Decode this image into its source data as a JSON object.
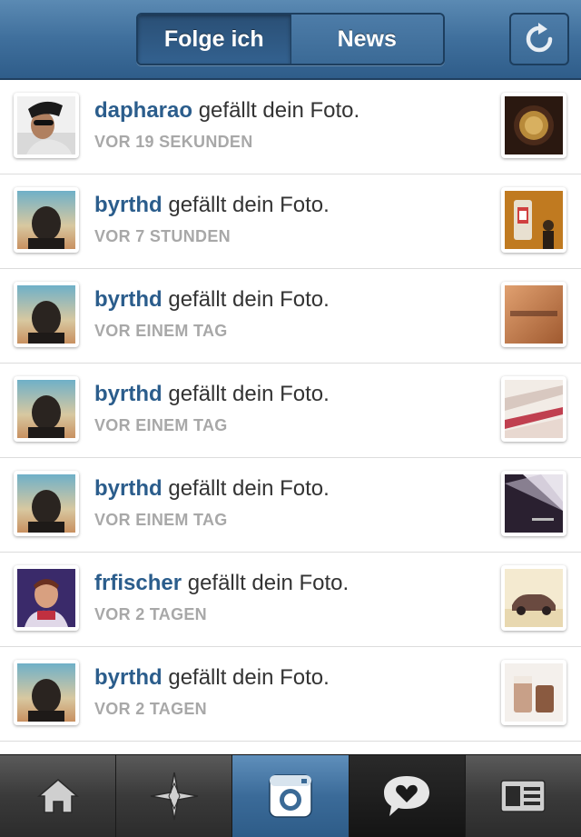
{
  "header": {
    "tabs": [
      {
        "label": "Folge ich",
        "active": true
      },
      {
        "label": "News",
        "active": false
      }
    ],
    "refresh_icon": "refresh-icon"
  },
  "colors": {
    "header_blue": "#3f6f9c",
    "username_blue": "#2b5d8c",
    "timestamp_gray": "#a8a8a8"
  },
  "activity": [
    {
      "user": "dapharao",
      "action": "gefällt dein Foto.",
      "time": "VOR 19 SEKUNDEN"
    },
    {
      "user": "byrthd",
      "action": "gefällt dein Foto.",
      "time": "VOR 7 STUNDEN"
    },
    {
      "user": "byrthd",
      "action": "gefällt dein Foto.",
      "time": "VOR EINEM TAG"
    },
    {
      "user": "byrthd",
      "action": "gefällt dein Foto.",
      "time": "VOR EINEM TAG"
    },
    {
      "user": "byrthd",
      "action": "gefällt dein Foto.",
      "time": "VOR EINEM TAG"
    },
    {
      "user": "frfischer",
      "action": "gefällt dein Foto.",
      "time": "VOR 2 TAGEN"
    },
    {
      "user": "byrthd",
      "action": "gefällt dein Foto.",
      "time": "VOR 2 TAGEN"
    }
  ],
  "tabbar": {
    "items": [
      {
        "icon": "home-icon"
      },
      {
        "icon": "explore-star-icon"
      },
      {
        "icon": "camera-icon"
      },
      {
        "icon": "news-heart-bubble-icon"
      },
      {
        "icon": "profile-card-icon"
      }
    ]
  }
}
